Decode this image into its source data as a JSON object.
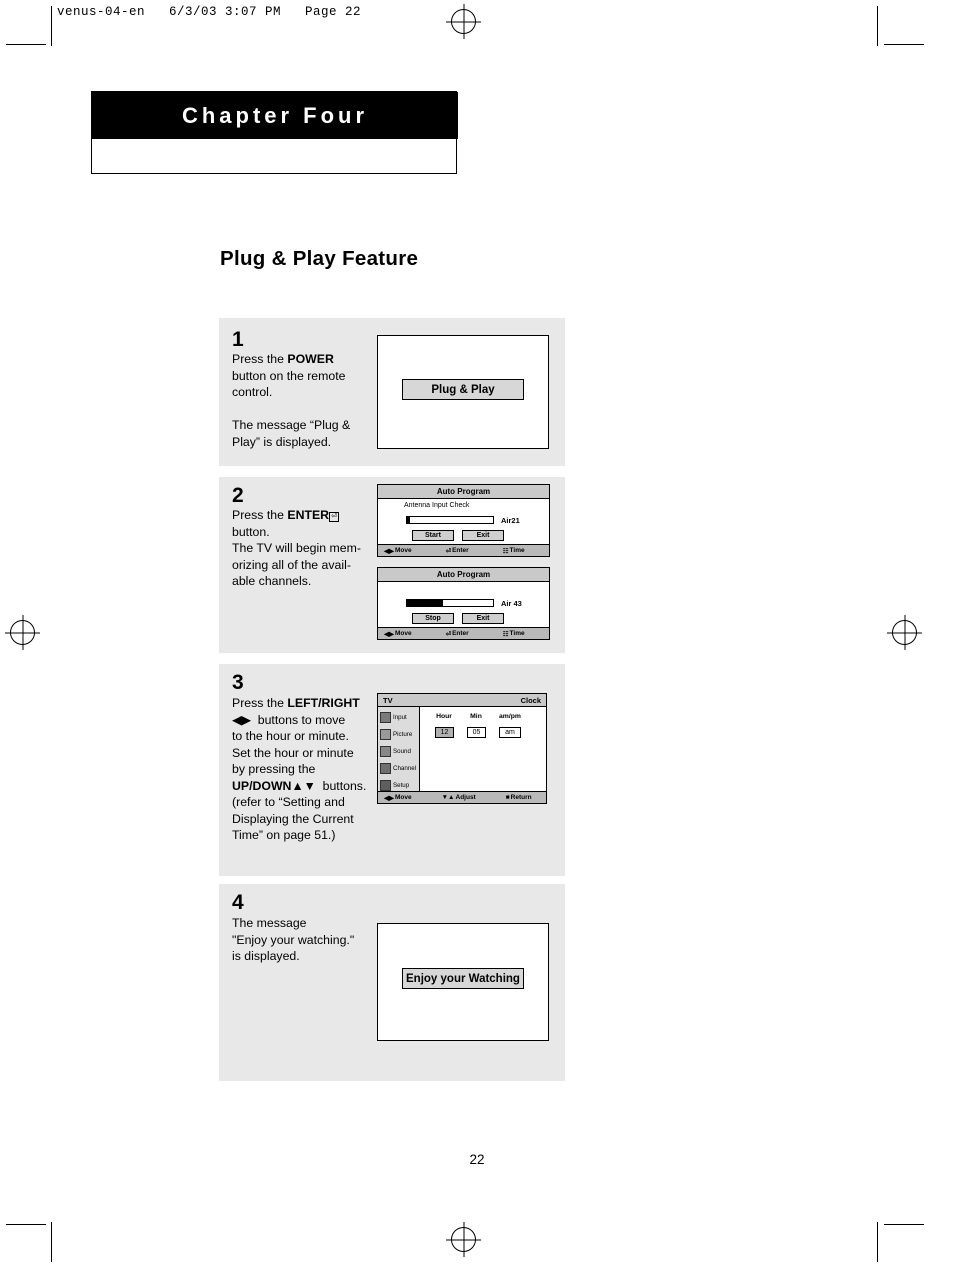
{
  "slug": "venus-04-en   6/3/03 3:07 PM   Page 22",
  "chapter": {
    "title": "Chapter Four"
  },
  "section": {
    "title": "Plug & Play Feature"
  },
  "page_number": "22",
  "steps": [
    {
      "number": "1",
      "text_lines": [
        "Press the POWER",
        "button on the remote",
        "control.",
        "",
        "The message “Plug &",
        "Play” is displayed."
      ],
      "bold_terms": [
        "POWER"
      ],
      "screen": {
        "banner": "Plug & Play"
      }
    },
    {
      "number": "2",
      "text_lines": [
        "Press the ENTER",
        "button.",
        "The TV will begin  mem-",
        "orizing all of the avail-",
        "able channels."
      ],
      "bold_terms": [
        "ENTER"
      ],
      "osd_top": {
        "title": "Auto Program",
        "subtitle": "Antenna Input Check",
        "channel": "Air21",
        "progress_percent": 3,
        "buttons": [
          "Start",
          "Exit"
        ],
        "footer": [
          "Move",
          "Enter",
          "Time"
        ]
      },
      "osd_bottom": {
        "title": "Auto Program",
        "subtitle": "",
        "channel": "Air 43",
        "progress_percent": 42,
        "buttons": [
          "Stop",
          "Exit"
        ],
        "footer": [
          "Move",
          "Enter",
          "Time"
        ]
      }
    },
    {
      "number": "3",
      "text_lines": [
        "Press the LEFT/RIGHT",
        "buttons to move",
        "to the hour or minute.",
        "Set the hour or minute",
        "by pressing the",
        "UP/DOWN buttons.",
        "(refer to “Setting and",
        "Displaying the Current",
        "Time” on page 51.)"
      ],
      "bold_terms": [
        "LEFT/RIGHT",
        "UP/DOWN"
      ],
      "menu": {
        "tv_label": "TV",
        "title": "Clock",
        "items": [
          "Input",
          "Picture",
          "Sound",
          "Channel",
          "Setup"
        ],
        "columns": [
          "Hour",
          "Min",
          "am/pm"
        ],
        "values": [
          "12",
          "05",
          "am"
        ],
        "footer": [
          "Move",
          "Adjust",
          "Return"
        ]
      }
    },
    {
      "number": "4",
      "text_lines": [
        "The message",
        "\"Enjoy your watching.\"",
        "is displayed."
      ],
      "bold_terms": [],
      "screen": {
        "banner": "Enjoy your Watching"
      }
    }
  ]
}
